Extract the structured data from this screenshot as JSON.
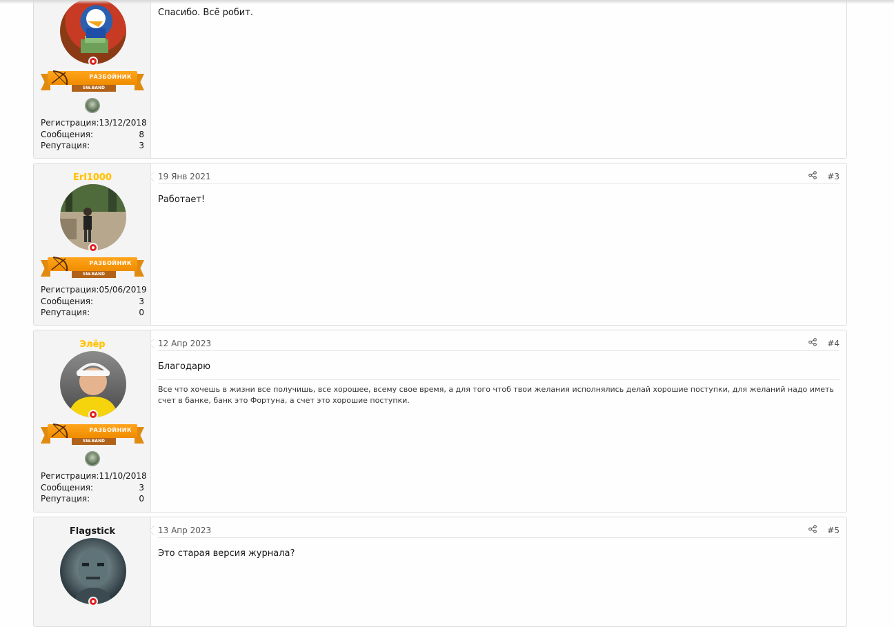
{
  "posts": [
    {
      "username": "",
      "rank_badge": "РАЗБОЙНИК",
      "rank_sub": "SW.BAND",
      "stats": [
        {
          "label": "Регистрация:",
          "value": "13/12/2018"
        },
        {
          "label": "Сообщения:",
          "value": "8"
        },
        {
          "label": "Репутация:",
          "value": "3"
        }
      ],
      "date": "",
      "number": "",
      "text": "Спасибо. Всё робит.",
      "signature": ""
    },
    {
      "username": "Erl1000",
      "rank_badge": "РАЗБОЙНИК",
      "rank_sub": "SW.BAND",
      "stats": [
        {
          "label": "Регистрация:",
          "value": "05/06/2019"
        },
        {
          "label": "Сообщения:",
          "value": "3"
        },
        {
          "label": "Репутация:",
          "value": "0"
        }
      ],
      "date": "19 Янв 2021",
      "number": "#3",
      "text": "Работает!",
      "signature": ""
    },
    {
      "username": "Элёр",
      "rank_badge": "РАЗБОЙНИК",
      "rank_sub": "SW.BAND",
      "stats": [
        {
          "label": "Регистрация:",
          "value": "11/10/2018"
        },
        {
          "label": "Сообщения:",
          "value": "3"
        },
        {
          "label": "Репутация:",
          "value": "0"
        }
      ],
      "date": "12 Апр 2023",
      "number": "#4",
      "text": "Благодарю",
      "signature": "Все что хочешь в жизни все получишь, все хорошее, всему свое время, а для того чтоб твои желания исполнялись делай хорошие поступки, для желаний надо иметь счет в банке, банк это Фортуна, а счет это хорошие поступки."
    },
    {
      "username": "Flagstick",
      "rank_badge": "",
      "rank_sub": "",
      "stats": [],
      "date": "13 Апр 2023",
      "number": "#5",
      "text": "Это старая версия журнала?",
      "signature": ""
    }
  ],
  "icons": {
    "share": "share-icon",
    "online": "online-status-icon",
    "rank_emblem": "rank-emblem-icon",
    "bow": "bow-arrow-icon"
  },
  "colors": {
    "username_gold": "#ffc107",
    "badge_orange": "#f79a10",
    "online_red": "#e0201f"
  }
}
